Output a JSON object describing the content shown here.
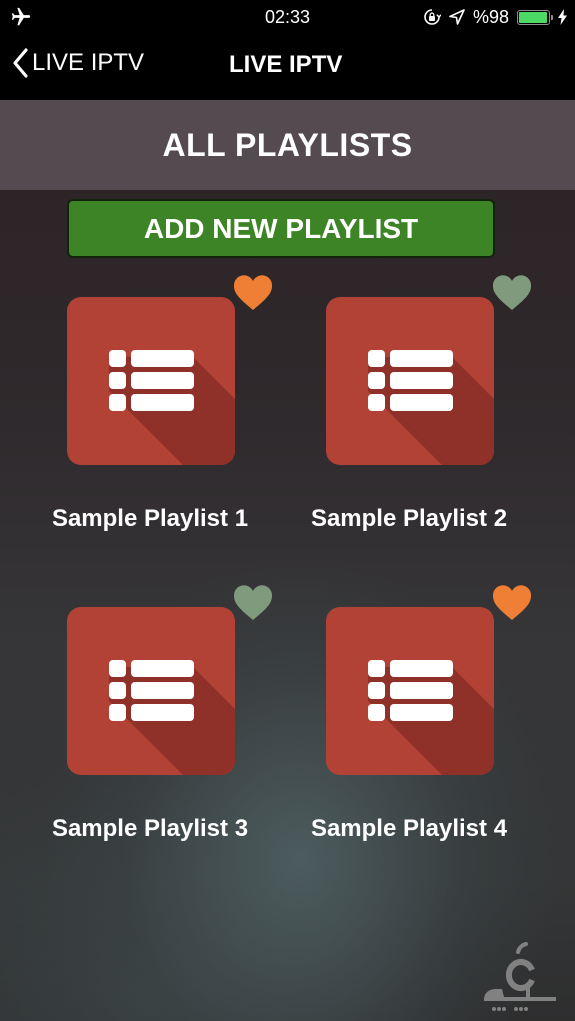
{
  "status_bar": {
    "time": "02:33",
    "battery_text": "%98",
    "battery_level_percent": 98,
    "icons": [
      "airplane-mode-icon",
      "orientation-lock-icon",
      "location-icon",
      "battery-icon",
      "charging-bolt-icon"
    ],
    "battery_color": "#4cd964"
  },
  "nav": {
    "back_label": "LIVE IPTV",
    "title": "LIVE IPTV"
  },
  "section": {
    "title": "ALL PLAYLISTS"
  },
  "add_button": {
    "label": "ADD NEW PLAYLIST",
    "color": "#3d8426"
  },
  "playlists": [
    {
      "name": "Sample Playlist 1",
      "favorite": true
    },
    {
      "name": "Sample Playlist 2",
      "favorite": false
    },
    {
      "name": "Sample Playlist 3",
      "favorite": false
    },
    {
      "name": "Sample Playlist 4",
      "favorite": true
    }
  ],
  "colors": {
    "tile": "#b34236",
    "heart_favorite": "#ee7f35",
    "heart_not_favorite": "#7f9a7c",
    "header_band": "#544a4f"
  },
  "watermark": {
    "icon": "sibche-logo-icon"
  }
}
